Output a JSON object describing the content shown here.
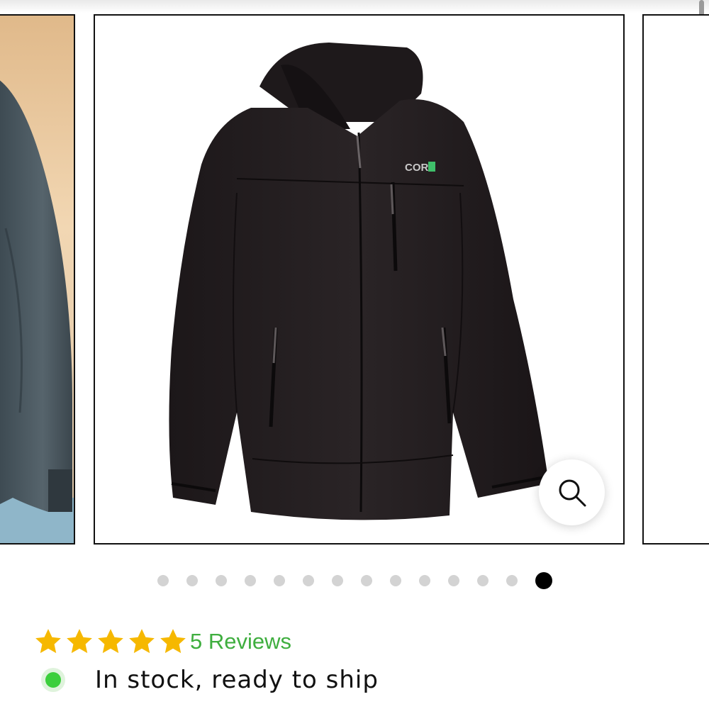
{
  "gallery": {
    "main_image_alt": "Black hooded rain jacket",
    "brand_logo": "COR",
    "zoom_icon": "search-icon",
    "dot_count": 14,
    "active_index": 13
  },
  "rating": {
    "stars": 5,
    "star_color": "#f6b800",
    "reviews_label": "5 Reviews",
    "reviews_color": "#3fae3f"
  },
  "stock": {
    "label": "In stock, ready to ship",
    "indicator_color": "#3ccf3c"
  }
}
